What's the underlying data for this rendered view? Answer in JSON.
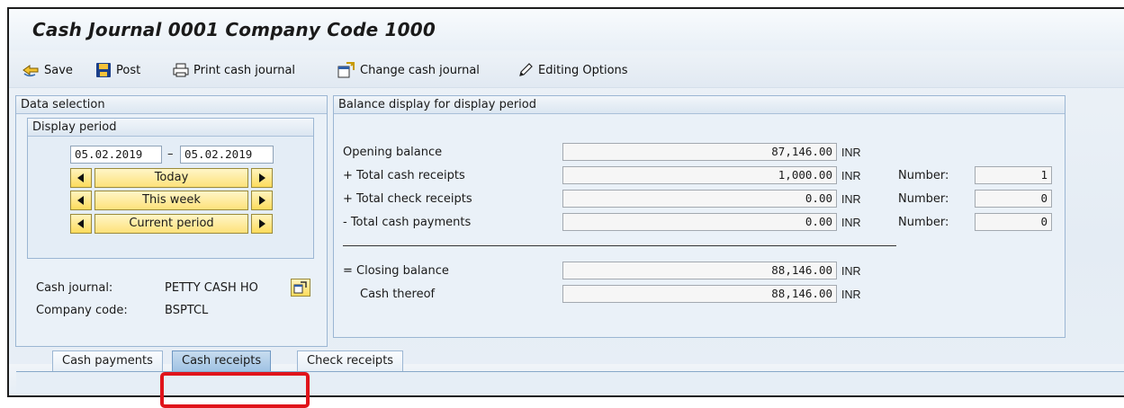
{
  "window": {
    "title": "Cash Journal 0001 Company Code 1000"
  },
  "toolbar": {
    "save": "Save",
    "post": "Post",
    "print": "Print cash journal",
    "change": "Change cash journal",
    "editing": "Editing Options"
  },
  "data_selection": {
    "heading": "Data selection",
    "display_period": {
      "heading": "Display period",
      "from": "05.02.2019",
      "dash": "–",
      "to": "05.02.2019",
      "today": "Today",
      "this_week": "This week",
      "current_period": "Current period"
    },
    "cash_journal_label": "Cash journal:",
    "cash_journal_value": "PETTY CASH HO",
    "company_code_label": "Company code:",
    "company_code_value": "BSPTCL"
  },
  "balance": {
    "heading": "Balance display for display period",
    "currency": "INR",
    "number_label": "Number:",
    "rows": [
      {
        "label": "Opening balance",
        "value": "87,146.00",
        "number": null
      },
      {
        "label": "+ Total cash receipts",
        "value": "1,000.00",
        "number": "1"
      },
      {
        "label": "+ Total check receipts",
        "value": "0.00",
        "number": "0"
      },
      {
        "label": "- Total cash payments",
        "value": "0.00",
        "number": "0"
      }
    ],
    "closing_label": "= Closing balance",
    "closing_value": "88,146.00",
    "cash_thereof_label": "Cash thereof",
    "cash_thereof_value": "88,146.00"
  },
  "tabs": [
    "Cash payments",
    "Cash receipts",
    "Check receipts"
  ],
  "active_tab": "Cash receipts",
  "colors": {
    "highlight": "#e0141b",
    "button_yellow": "#fde27a",
    "panel_border": "#9bb6d3"
  }
}
